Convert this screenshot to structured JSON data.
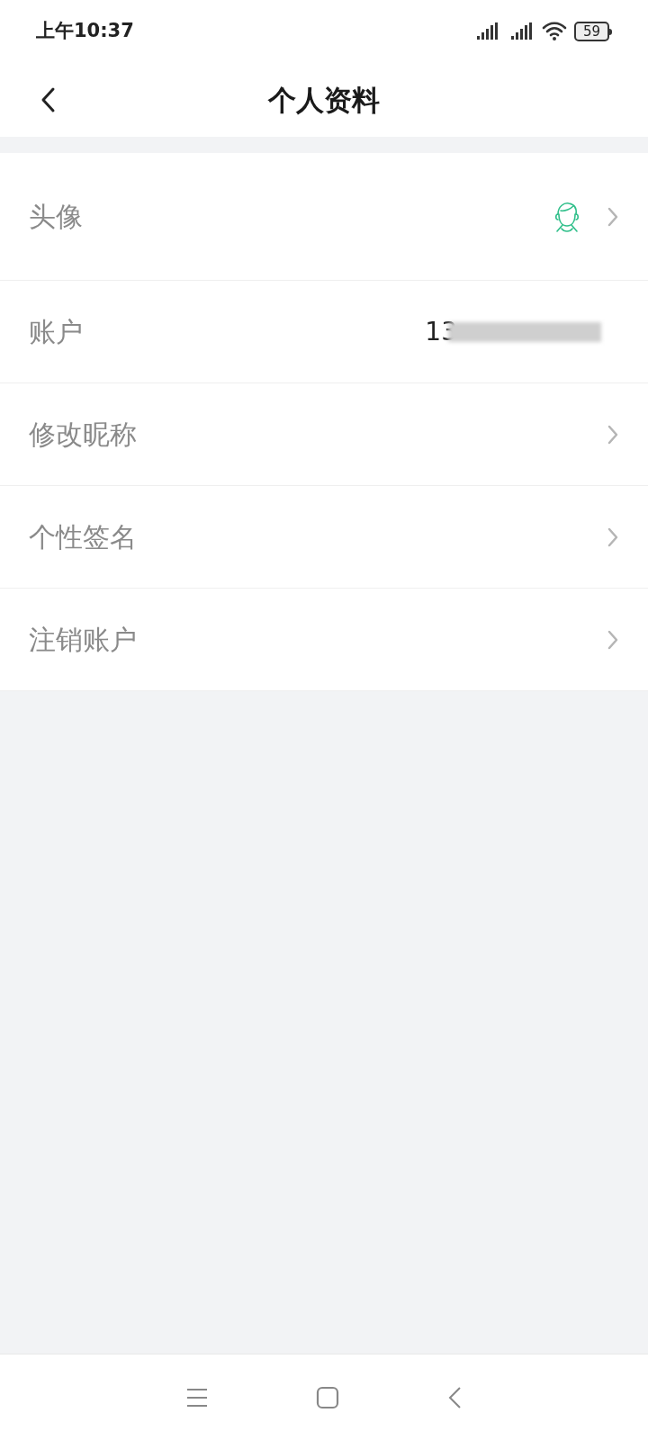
{
  "status_bar": {
    "time": "上午10:37",
    "battery": "59"
  },
  "header": {
    "title": "个人资料"
  },
  "rows": [
    {
      "kind": "avatar",
      "label": "头像"
    },
    {
      "kind": "value",
      "label": "账户",
      "value": "13",
      "redacted": true
    },
    {
      "kind": "link",
      "label": "修改昵称"
    },
    {
      "kind": "link",
      "label": "个性签名"
    },
    {
      "kind": "link",
      "label": "注销账户"
    }
  ]
}
